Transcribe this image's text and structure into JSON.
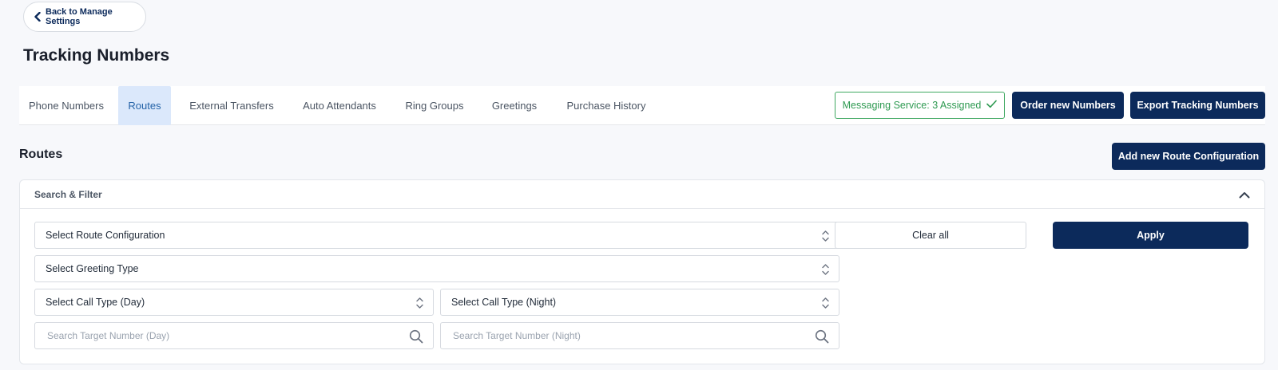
{
  "back_button": {
    "label": "Back to Manage Settings",
    "icon": "chevron-left-icon"
  },
  "page_title": "Tracking Numbers",
  "tabs": [
    {
      "label": "Phone Numbers",
      "active": false
    },
    {
      "label": "Routes",
      "active": true
    },
    {
      "label": "External Transfers",
      "active": false
    },
    {
      "label": "Auto Attendants",
      "active": false
    },
    {
      "label": "Ring Groups",
      "active": false
    },
    {
      "label": "Greetings",
      "active": false
    },
    {
      "label": "Purchase History",
      "active": false
    }
  ],
  "header_actions": {
    "messaging_service": "Messaging Service: 3 Assigned",
    "order_numbers": "Order new Numbers",
    "export_numbers": "Export Tracking Numbers"
  },
  "section": {
    "title": "Routes",
    "add_button": "Add new Route Configuration"
  },
  "filter": {
    "title": "Search & Filter",
    "route_configuration": "Select Route Configuration",
    "greeting_type": "Select Greeting Type",
    "call_type_day": "Select Call Type (Day)",
    "call_type_night": "Select Call Type (Night)",
    "target_day_placeholder": "Search Target Number (Day)",
    "target_night_placeholder": "Search Target Number (Night)",
    "clear_all": "Clear all",
    "apply": "Apply"
  },
  "colors": {
    "primary": "#0c2a5b",
    "active_tab_bg": "#dbe8fb",
    "active_tab_text": "#2563a8",
    "success": "#2f9a52"
  }
}
